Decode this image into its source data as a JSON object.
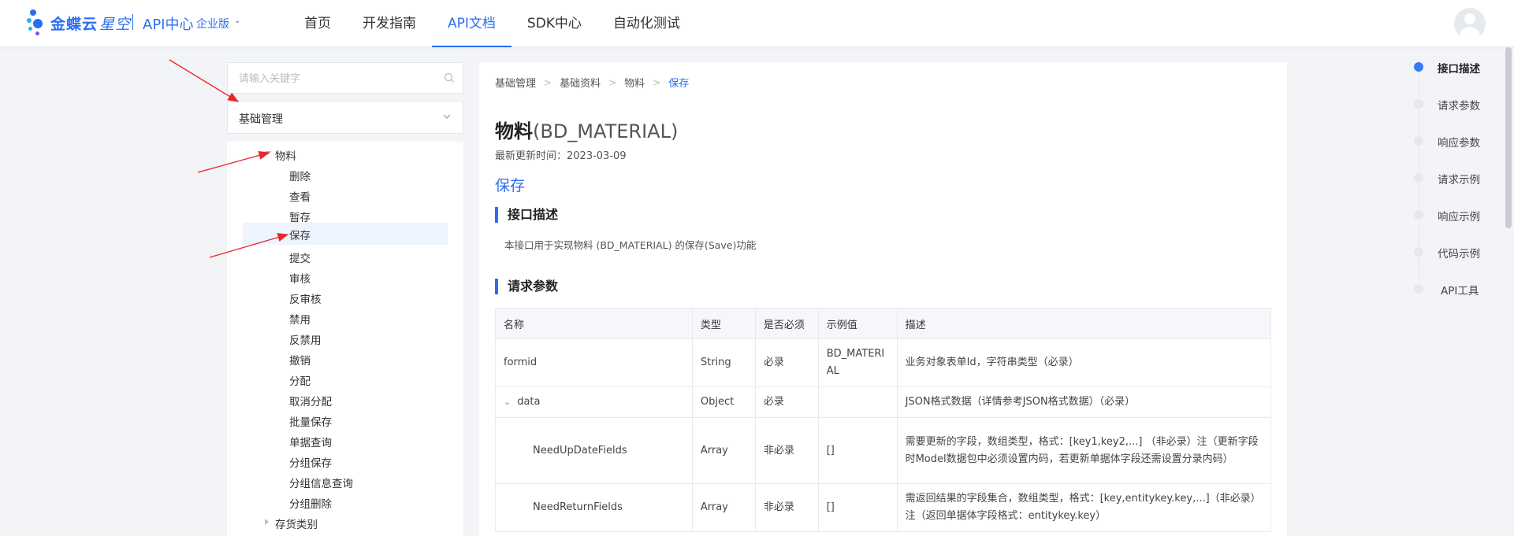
{
  "header": {
    "brand": "金蝶云",
    "brand_italic": "星空",
    "api_center": "API中心",
    "edition": "企业版",
    "nav": [
      "首页",
      "开发指南",
      "API文档",
      "SDK中心",
      "自动化测试"
    ],
    "active_nav": "API文档"
  },
  "sidebar": {
    "search_placeholder": "请输入关键字",
    "category_select": "基础管理",
    "tree": {
      "parent": "物料",
      "children": [
        "删除",
        "查看",
        "暂存",
        "保存",
        "提交",
        "审核",
        "反审核",
        "禁用",
        "反禁用",
        "撤销",
        "分配",
        "取消分配",
        "批量保存",
        "单据查询",
        "分组保存",
        "分组信息查询",
        "分组删除"
      ],
      "selected": "保存",
      "next_parent": "存货类别"
    }
  },
  "breadcrumb": [
    "基础管理",
    "基础资料",
    "物料",
    "保存"
  ],
  "doc": {
    "title": "物料",
    "title_code": "(BD_MATERIAL)",
    "updated": "最新更新时间：2023-03-09",
    "operation": "保存",
    "section_desc": "接口描述",
    "description": "本接口用于实现物料 (BD_MATERIAL) 的保存(Save)功能",
    "section_params": "请求参数"
  },
  "params_table": {
    "headers": [
      "名称",
      "类型",
      "是否必须",
      "示例值",
      "描述"
    ],
    "rows": [
      {
        "name": "formid",
        "type": "String",
        "required": "必录",
        "example": "BD_MATERIAL",
        "desc": "业务对象表单Id，字符串类型（必录）"
      },
      {
        "name": "data",
        "type": "Object",
        "required": "必录",
        "example": "",
        "desc": "JSON格式数据（详情参考JSON格式数据）（必录）"
      },
      {
        "name": "NeedUpDateFields",
        "type": "Array",
        "required": "非必录",
        "example": "[]",
        "desc": "需要更新的字段，数组类型，格式：[key1,key2,...] （非必录）注（更新字段时Model数据包中必须设置内码，若更新单据体字段还需设置分录内码）"
      },
      {
        "name": "NeedReturnFields",
        "type": "Array",
        "required": "非必录",
        "example": "[]",
        "desc": "需返回结果的字段集合，数组类型，格式：[key,entitykey.key,...]（非必录） 注（返回单据体字段格式：entitykey.key）"
      }
    ]
  },
  "anchors": [
    "接口描述",
    "请求参数",
    "响应参数",
    "请求示例",
    "响应示例",
    "代码示例",
    "API工具"
  ],
  "active_anchor": "接口描述",
  "colors": {
    "accent": "#2a6ef0",
    "annotation": "#e8262a"
  }
}
